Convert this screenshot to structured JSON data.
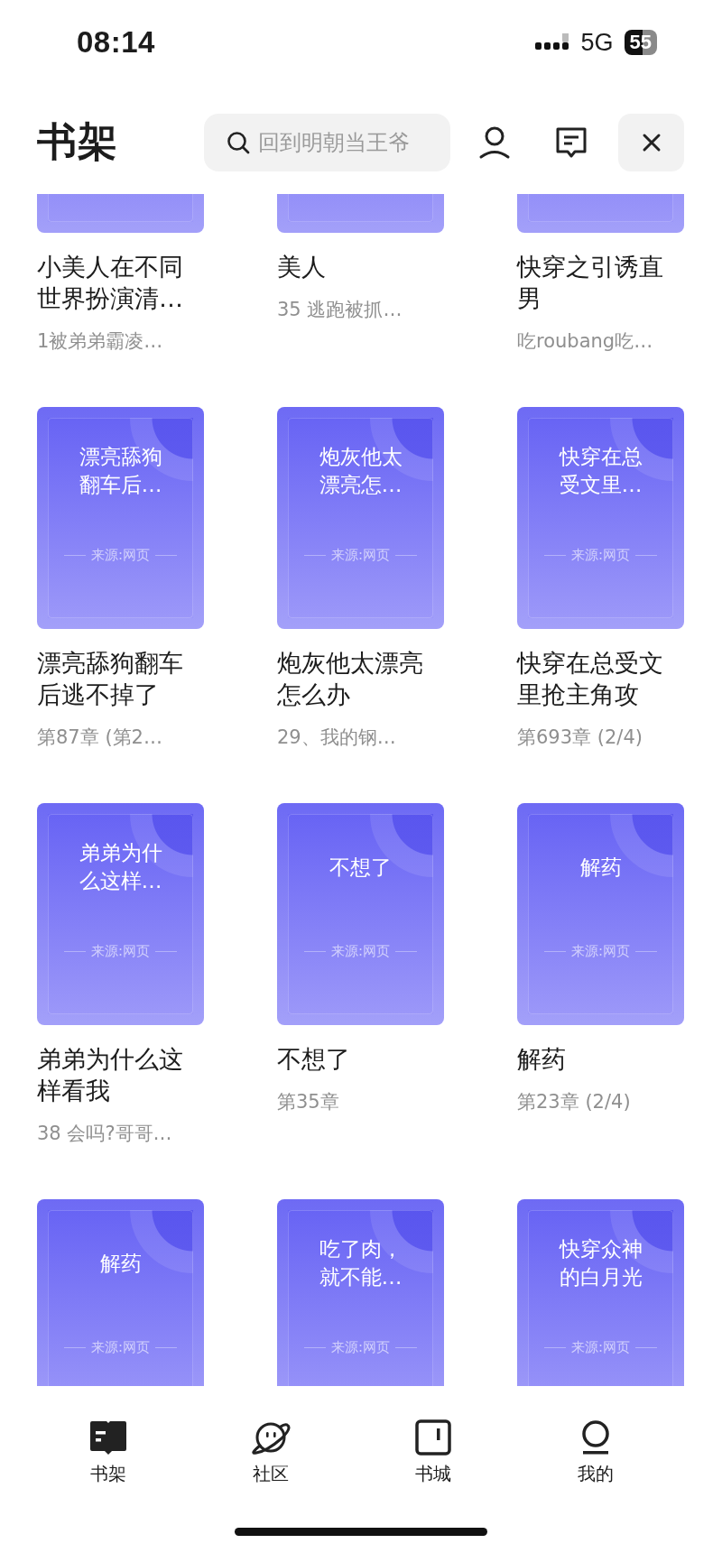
{
  "status_bar": {
    "time": "08:14",
    "network": "5G",
    "battery": "55"
  },
  "header": {
    "title": "书架",
    "search": {
      "placeholder": "回到明朝当王爷"
    }
  },
  "books": [
    {
      "title": "小美人在不同世界扮演清…",
      "subtitle": "1被弟弟霸凌…"
    },
    {
      "title": "美人",
      "subtitle": "35 逃跑被抓…"
    },
    {
      "title": "快穿之引诱直男",
      "subtitle": "吃roubang吃…"
    },
    {
      "cover_title": "漂亮舔狗翻车后…",
      "source": "来源:网页",
      "title": "漂亮舔狗翻车后逃不掉了",
      "subtitle": "第87章 (第2…"
    },
    {
      "cover_title": "炮灰他太漂亮怎…",
      "source": "来源:网页",
      "title": "炮灰他太漂亮怎么办",
      "subtitle": "29、我的钢…"
    },
    {
      "cover_title": "快穿在总受文里…",
      "source": "来源:网页",
      "title": "快穿在总受文里抢主角攻",
      "subtitle": "第693章 (2/4)"
    },
    {
      "cover_title": "弟弟为什么这样…",
      "source": "来源:网页",
      "title": "弟弟为什么这样看我",
      "subtitle": "38 会吗?哥哥…"
    },
    {
      "cover_title": "不想了",
      "source": "来源:网页",
      "title": "不想了",
      "subtitle": "第35章"
    },
    {
      "cover_title": "解药",
      "source": "来源:网页",
      "title": "解药",
      "subtitle": "第23章 (2/4)"
    },
    {
      "cover_title": "解药",
      "source": "来源:网页"
    },
    {
      "cover_title": "吃了肉，就不能…",
      "source": "来源:网页"
    },
    {
      "cover_title": "快穿众神的白月光",
      "source": "来源:网页"
    }
  ],
  "tab_bar": [
    {
      "label": "书架",
      "kind": "book",
      "selected": true
    },
    {
      "label": "社区",
      "kind": "planet",
      "selected": false
    },
    {
      "label": "书城",
      "kind": "store",
      "selected": false
    },
    {
      "label": "我的",
      "kind": "person",
      "selected": false
    }
  ]
}
